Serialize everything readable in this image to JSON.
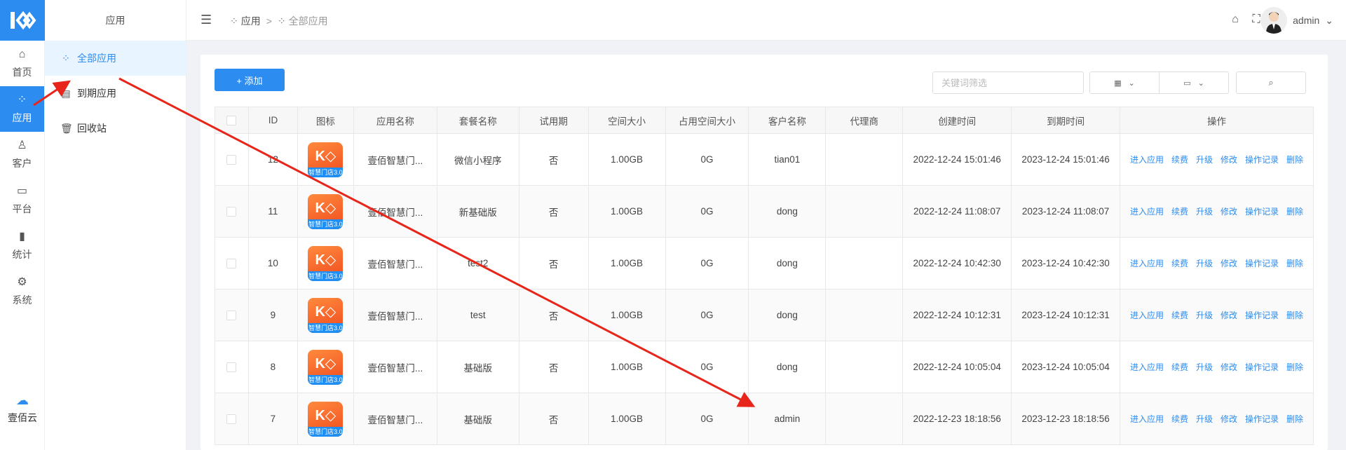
{
  "rail": {
    "items": [
      {
        "label": "首页",
        "icon": "home-icon"
      },
      {
        "label": "应用",
        "icon": "apps-icon"
      },
      {
        "label": "客户",
        "icon": "user-icon"
      },
      {
        "label": "平台",
        "icon": "monitor-icon"
      },
      {
        "label": "统计",
        "icon": "bar-chart-icon"
      },
      {
        "label": "系统",
        "icon": "gear-icon"
      }
    ],
    "cloud_label": "壹佰云"
  },
  "submenu": {
    "title": "应用",
    "items": [
      {
        "label": "全部应用",
        "icon": "apps-icon"
      },
      {
        "label": "到期应用",
        "icon": "expire-icon"
      },
      {
        "label": "回收站",
        "icon": "trash-icon"
      }
    ]
  },
  "header": {
    "breadcrumb": [
      "应用",
      "全部应用"
    ],
    "separator": ">",
    "user": "admin"
  },
  "toolbar": {
    "add_label": "+ 添加",
    "search_placeholder": "关键词筛选"
  },
  "table": {
    "columns": [
      "ID",
      "图标",
      "应用名称",
      "套餐名称",
      "试用期",
      "空间大小",
      "占用空间大小",
      "客户名称",
      "代理商",
      "创建时间",
      "到期时间",
      "操作"
    ],
    "icon_tag": "智慧门店3.0",
    "ops": [
      "进入应用",
      "续费",
      "升级",
      "修改",
      "操作记录",
      "删除"
    ],
    "rows": [
      {
        "id": "12",
        "name": "壹佰智慧门...",
        "plan": "微信小程序",
        "trial": "否",
        "space": "1.00GB",
        "used": "0G",
        "customer": "tian01",
        "agent": "",
        "created": "2022-12-24 15:01:46",
        "expires": "2023-12-24 15:01:46"
      },
      {
        "id": "11",
        "name": "壹佰智慧门...",
        "plan": "新基础版",
        "trial": "否",
        "space": "1.00GB",
        "used": "0G",
        "customer": "dong",
        "agent": "",
        "created": "2022-12-24 11:08:07",
        "expires": "2023-12-24 11:08:07"
      },
      {
        "id": "10",
        "name": "壹佰智慧门...",
        "plan": "test2",
        "trial": "否",
        "space": "1.00GB",
        "used": "0G",
        "customer": "dong",
        "agent": "",
        "created": "2022-12-24 10:42:30",
        "expires": "2023-12-24 10:42:30"
      },
      {
        "id": "9",
        "name": "壹佰智慧门...",
        "plan": "test",
        "trial": "否",
        "space": "1.00GB",
        "used": "0G",
        "customer": "dong",
        "agent": "",
        "created": "2022-12-24 10:12:31",
        "expires": "2023-12-24 10:12:31"
      },
      {
        "id": "8",
        "name": "壹佰智慧门...",
        "plan": "基础版",
        "trial": "否",
        "space": "1.00GB",
        "used": "0G",
        "customer": "dong",
        "agent": "",
        "created": "2022-12-24 10:05:04",
        "expires": "2023-12-24 10:05:04"
      },
      {
        "id": "7",
        "name": "壹佰智慧门...",
        "plan": "基础版",
        "trial": "否",
        "space": "1.00GB",
        "used": "0G",
        "customer": "admin",
        "agent": "",
        "created": "2022-12-23 18:18:56",
        "expires": "2023-12-23 18:18:56"
      }
    ]
  },
  "colors": {
    "accent": "#2d8cf0",
    "arrow": "#e8251a"
  }
}
